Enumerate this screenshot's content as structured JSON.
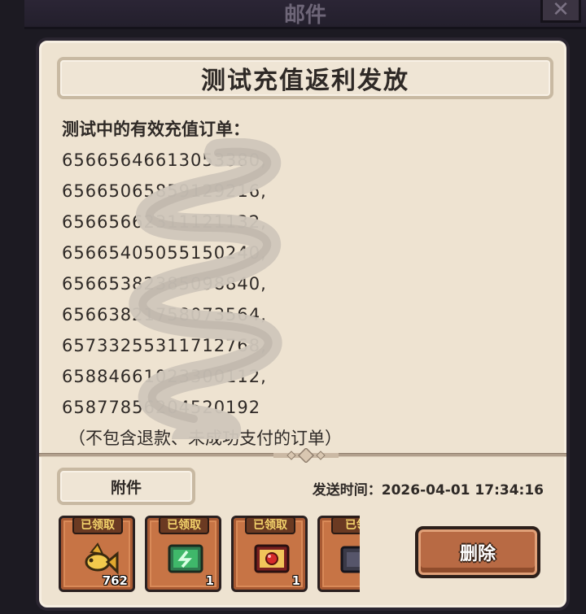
{
  "window": {
    "title": "邮件",
    "close_glyph": "✕"
  },
  "mail": {
    "title": "测试充值返利发放",
    "heading": "测试中的有效充值订单：",
    "orders": [
      "65665646613053380,",
      "65665065859129216,",
      "65665662311121132,",
      "65665405055150240,",
      "65665382385098840,",
      "65663821758073564,",
      "65733255311712768,",
      "65884661023300112,",
      "65877856204520192"
    ],
    "note": "（不包含退款、未成功支付的订单）",
    "attachments_label": "附件",
    "send_time": "发送时间：2026-04-01 17:34:16",
    "delete_label": "删除"
  },
  "attachments": [
    {
      "claimed": "已领取",
      "icon": "golden-fish-icon",
      "count": "762"
    },
    {
      "claimed": "已领取",
      "icon": "energy-card-icon",
      "count": "1"
    },
    {
      "claimed": "已领取",
      "icon": "red-gem-card-icon",
      "count": "1"
    },
    {
      "claimed": "已领",
      "icon": "dark-chest-icon",
      "count": ""
    }
  ],
  "colors": {
    "panel": "#eee3d1",
    "item_bg": "#c77445",
    "claimed_text": "#f4d36b",
    "delete_button": "#b86a44"
  }
}
